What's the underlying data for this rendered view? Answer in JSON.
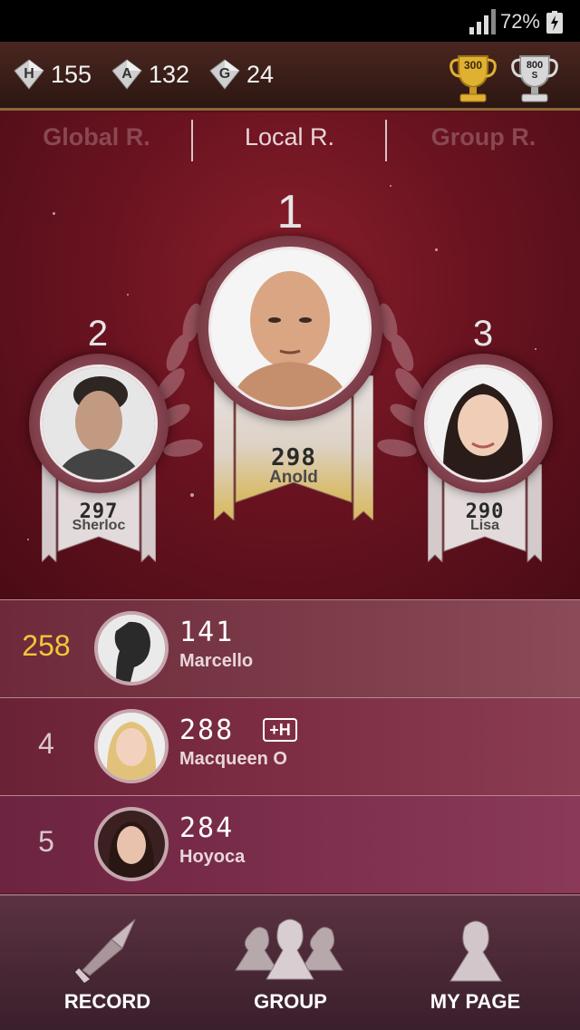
{
  "status_bar": {
    "battery_percent": "72%"
  },
  "stats": {
    "h": {
      "letter": "H",
      "value": "155"
    },
    "a": {
      "letter": "A",
      "value": "132"
    },
    "g": {
      "letter": "G",
      "value": "24"
    },
    "trophy_gold": {
      "value": "300"
    },
    "trophy_silver": {
      "value": "800",
      "unit": "S"
    }
  },
  "tabs": [
    {
      "label": "Global R.",
      "active": false
    },
    {
      "label": "Local R.",
      "active": true
    },
    {
      "label": "Group R.",
      "active": false
    }
  ],
  "podium": {
    "first": {
      "rank": "1",
      "score": "298",
      "name": "Anold"
    },
    "second": {
      "rank": "2",
      "score": "297",
      "name": "Sherloc"
    },
    "third": {
      "rank": "3",
      "score": "290",
      "name": "Lisa"
    }
  },
  "list": [
    {
      "rank": "258",
      "score": "141",
      "name": "Marcello",
      "highlight": true,
      "badge": ""
    },
    {
      "rank": "4",
      "score": "288",
      "name": "Macqueen O",
      "highlight": false,
      "badge": "+H"
    },
    {
      "rank": "5",
      "score": "284",
      "name": "Hoyoca",
      "highlight": false,
      "badge": ""
    }
  ],
  "nav": {
    "record": "RECORD",
    "group": "GROUP",
    "mypage": "MY PAGE"
  },
  "colors": {
    "accent_gold": "#f0c83c",
    "bg_red": "#6a1320"
  }
}
